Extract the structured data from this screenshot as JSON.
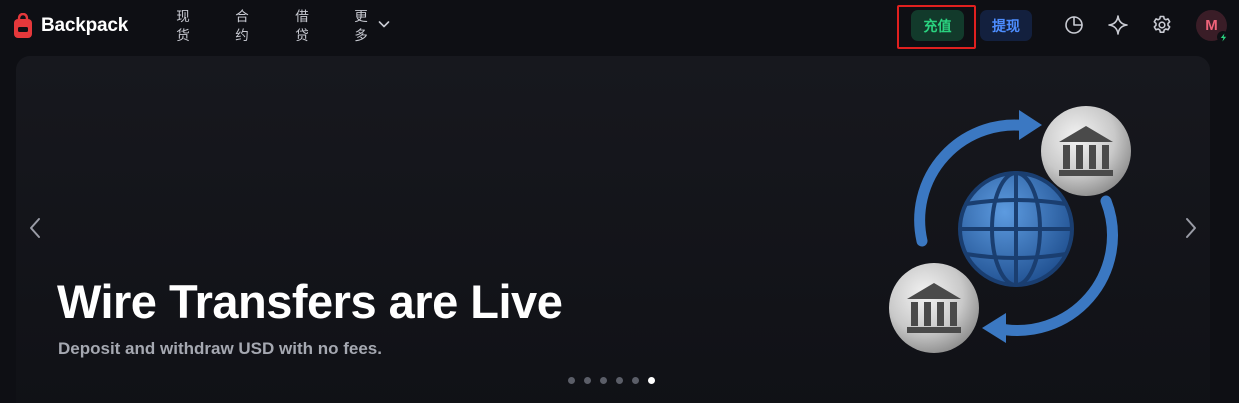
{
  "app": {
    "name": "Backpack"
  },
  "nav": {
    "items": [
      {
        "label": "现货",
        "icon": "none"
      },
      {
        "label": "合约",
        "icon": "none"
      },
      {
        "label": "借贷",
        "icon": "none"
      },
      {
        "label": "更多",
        "icon": "chevron-down-icon"
      }
    ]
  },
  "header": {
    "deposit_label": "充值",
    "withdraw_label": "提现",
    "icons": [
      "portfolio-pie-icon",
      "sparkle-icon",
      "settings-gear-icon"
    ],
    "avatar_initial": "M",
    "avatar_badge_icon": "lightning-icon",
    "colors": {
      "deposit_text": "#2ad27f",
      "deposit_bg": "#123a2b",
      "withdraw_text": "#4d8dff",
      "withdraw_bg": "#13203e",
      "highlight_border": "#e0201f",
      "brand_red": "#e5383b"
    }
  },
  "banner": {
    "title": "Wire Transfers are Live",
    "subtitle": "Deposit and withdraw USD with no fees.",
    "illustration": "bank-globe-transfer-illustration",
    "slide_count": 6,
    "active_slide": 6
  }
}
